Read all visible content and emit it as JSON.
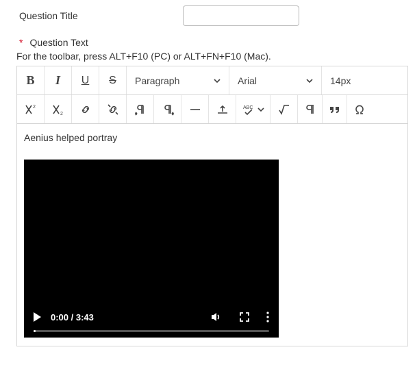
{
  "fields": {
    "title_label": "Question Title",
    "title_value": "",
    "title_placeholder": "",
    "text_label": "Question Text",
    "required_mark": "*",
    "toolbar_hint": "For the toolbar, press ALT+F10 (PC) or ALT+FN+F10 (Mac)."
  },
  "toolbar": {
    "bold": "B",
    "italic": "I",
    "underline": "U",
    "strike": "S",
    "block_format": "Paragraph",
    "font_family": "Arial",
    "font_size": "14px",
    "spellcheck_label": "ABC"
  },
  "content": {
    "text": "Aenius helped portray"
  },
  "video": {
    "current_time": "0:00",
    "duration": "3:43"
  }
}
